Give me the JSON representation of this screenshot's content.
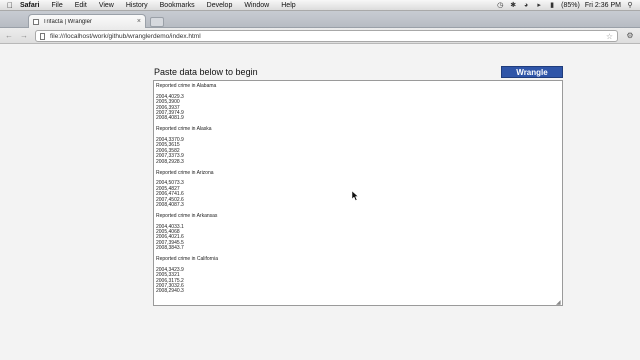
{
  "menubar": {
    "apple_icon": "apple-icon",
    "items": [
      "Safari",
      "File",
      "Edit",
      "View",
      "History",
      "Bookmarks",
      "Develop",
      "Window",
      "Help"
    ],
    "battery": "(85%)",
    "clock": "Fri 2:36 PM"
  },
  "browser": {
    "tab_title": "Trifacta | Wrangler",
    "url": "file:///localhost/work/github/wranglerdemo/index.html"
  },
  "page": {
    "heading": "Paste data below to begin",
    "wrangle_label": "Wrangle",
    "textarea_value": "Reported crime in Alabama\n\n2004,4029.3\n2005,3900\n2006,3937\n2007,3974.9\n2008,4081.9\n\nReported crime in Alaska\n\n2004,3370.9\n2005,3615\n2006,3582\n2007,3373.9\n2008,2928.3\n\nReported crime in Arizona\n\n2004,5073.3\n2005,4827\n2006,4741.6\n2007,4502.6\n2008,4087.3\n\nReported crime in Arkansas\n\n2004,4033.1\n2005,4068\n2006,4021.6\n2007,3945.5\n2008,3843.7\n\nReported crime in California\n\n2004,3423.9\n2005,3321\n2006,3175.2\n2007,3032.6\n2008,2940.3"
  },
  "colors": {
    "wrangle_button": "#2f55a8"
  }
}
